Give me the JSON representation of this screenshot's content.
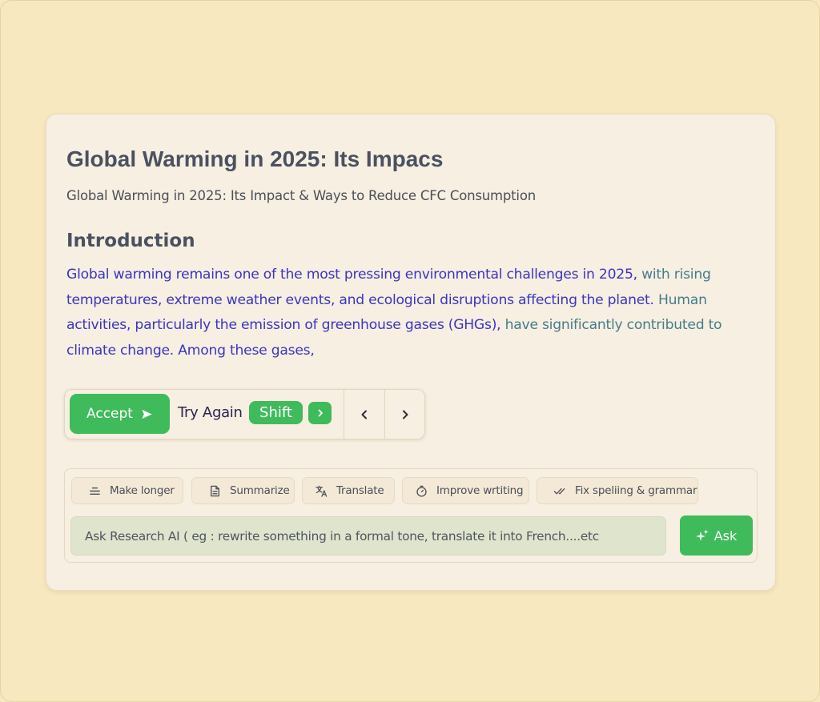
{
  "document": {
    "title": "Global Warming in 2025: Its Impacs",
    "subtitle": "Global Warming in 2025: Its Impact & Ways to Reduce CFC Consumption",
    "section_heading": "Introduction",
    "paragraph_segments": [
      {
        "text": "Global warming remains one of the most pressing environmental challenges in 2025, ",
        "tone": "blue"
      },
      {
        "text": "with rising ",
        "tone": "teal"
      },
      {
        "text": "temperatures, extreme weather events, and ecological disruptions affecting the planet. ",
        "tone": "blue"
      },
      {
        "text": "Human ",
        "tone": "teal"
      },
      {
        "text": "activities, particularly the emission of greenhouse gases (GHGs), ",
        "tone": "blue"
      },
      {
        "text": "have significantly contributed to ",
        "tone": "teal"
      },
      {
        "text": "climate change. Among these gases,",
        "tone": "blue"
      }
    ]
  },
  "suggestion_bar": {
    "accept_label": "Accept",
    "try_again_label": "Try Again",
    "shift_key_label": "Shift",
    "icons": {
      "accept": "send-arrow-icon",
      "next_key": "chevron-right-icon",
      "prev": "chevron-left-icon",
      "next": "chevron-right-icon"
    }
  },
  "assist": {
    "actions": [
      {
        "label": "Make longer",
        "icon": "text-lines-icon"
      },
      {
        "label": "Summarize",
        "icon": "document-icon"
      },
      {
        "label": "Translate",
        "icon": "translate-icon"
      },
      {
        "label": "Improve wrtiting",
        "icon": "timer-icon"
      },
      {
        "label": "Fix speliing & grammar",
        "icon": "double-check-icon"
      }
    ],
    "input_placeholder": "Ask Research AI ( eg : rewrite something in a formal tone, translate it into French....etc",
    "ask_label": "Ask",
    "ask_icon": "sparkle-icon"
  },
  "colors": {
    "accent_green": "#3fbb5c",
    "text_blue": "#3c35c2",
    "text_teal": "#457c8c",
    "page_background": "#f8e8c0",
    "card_background": "#f7efe1"
  }
}
